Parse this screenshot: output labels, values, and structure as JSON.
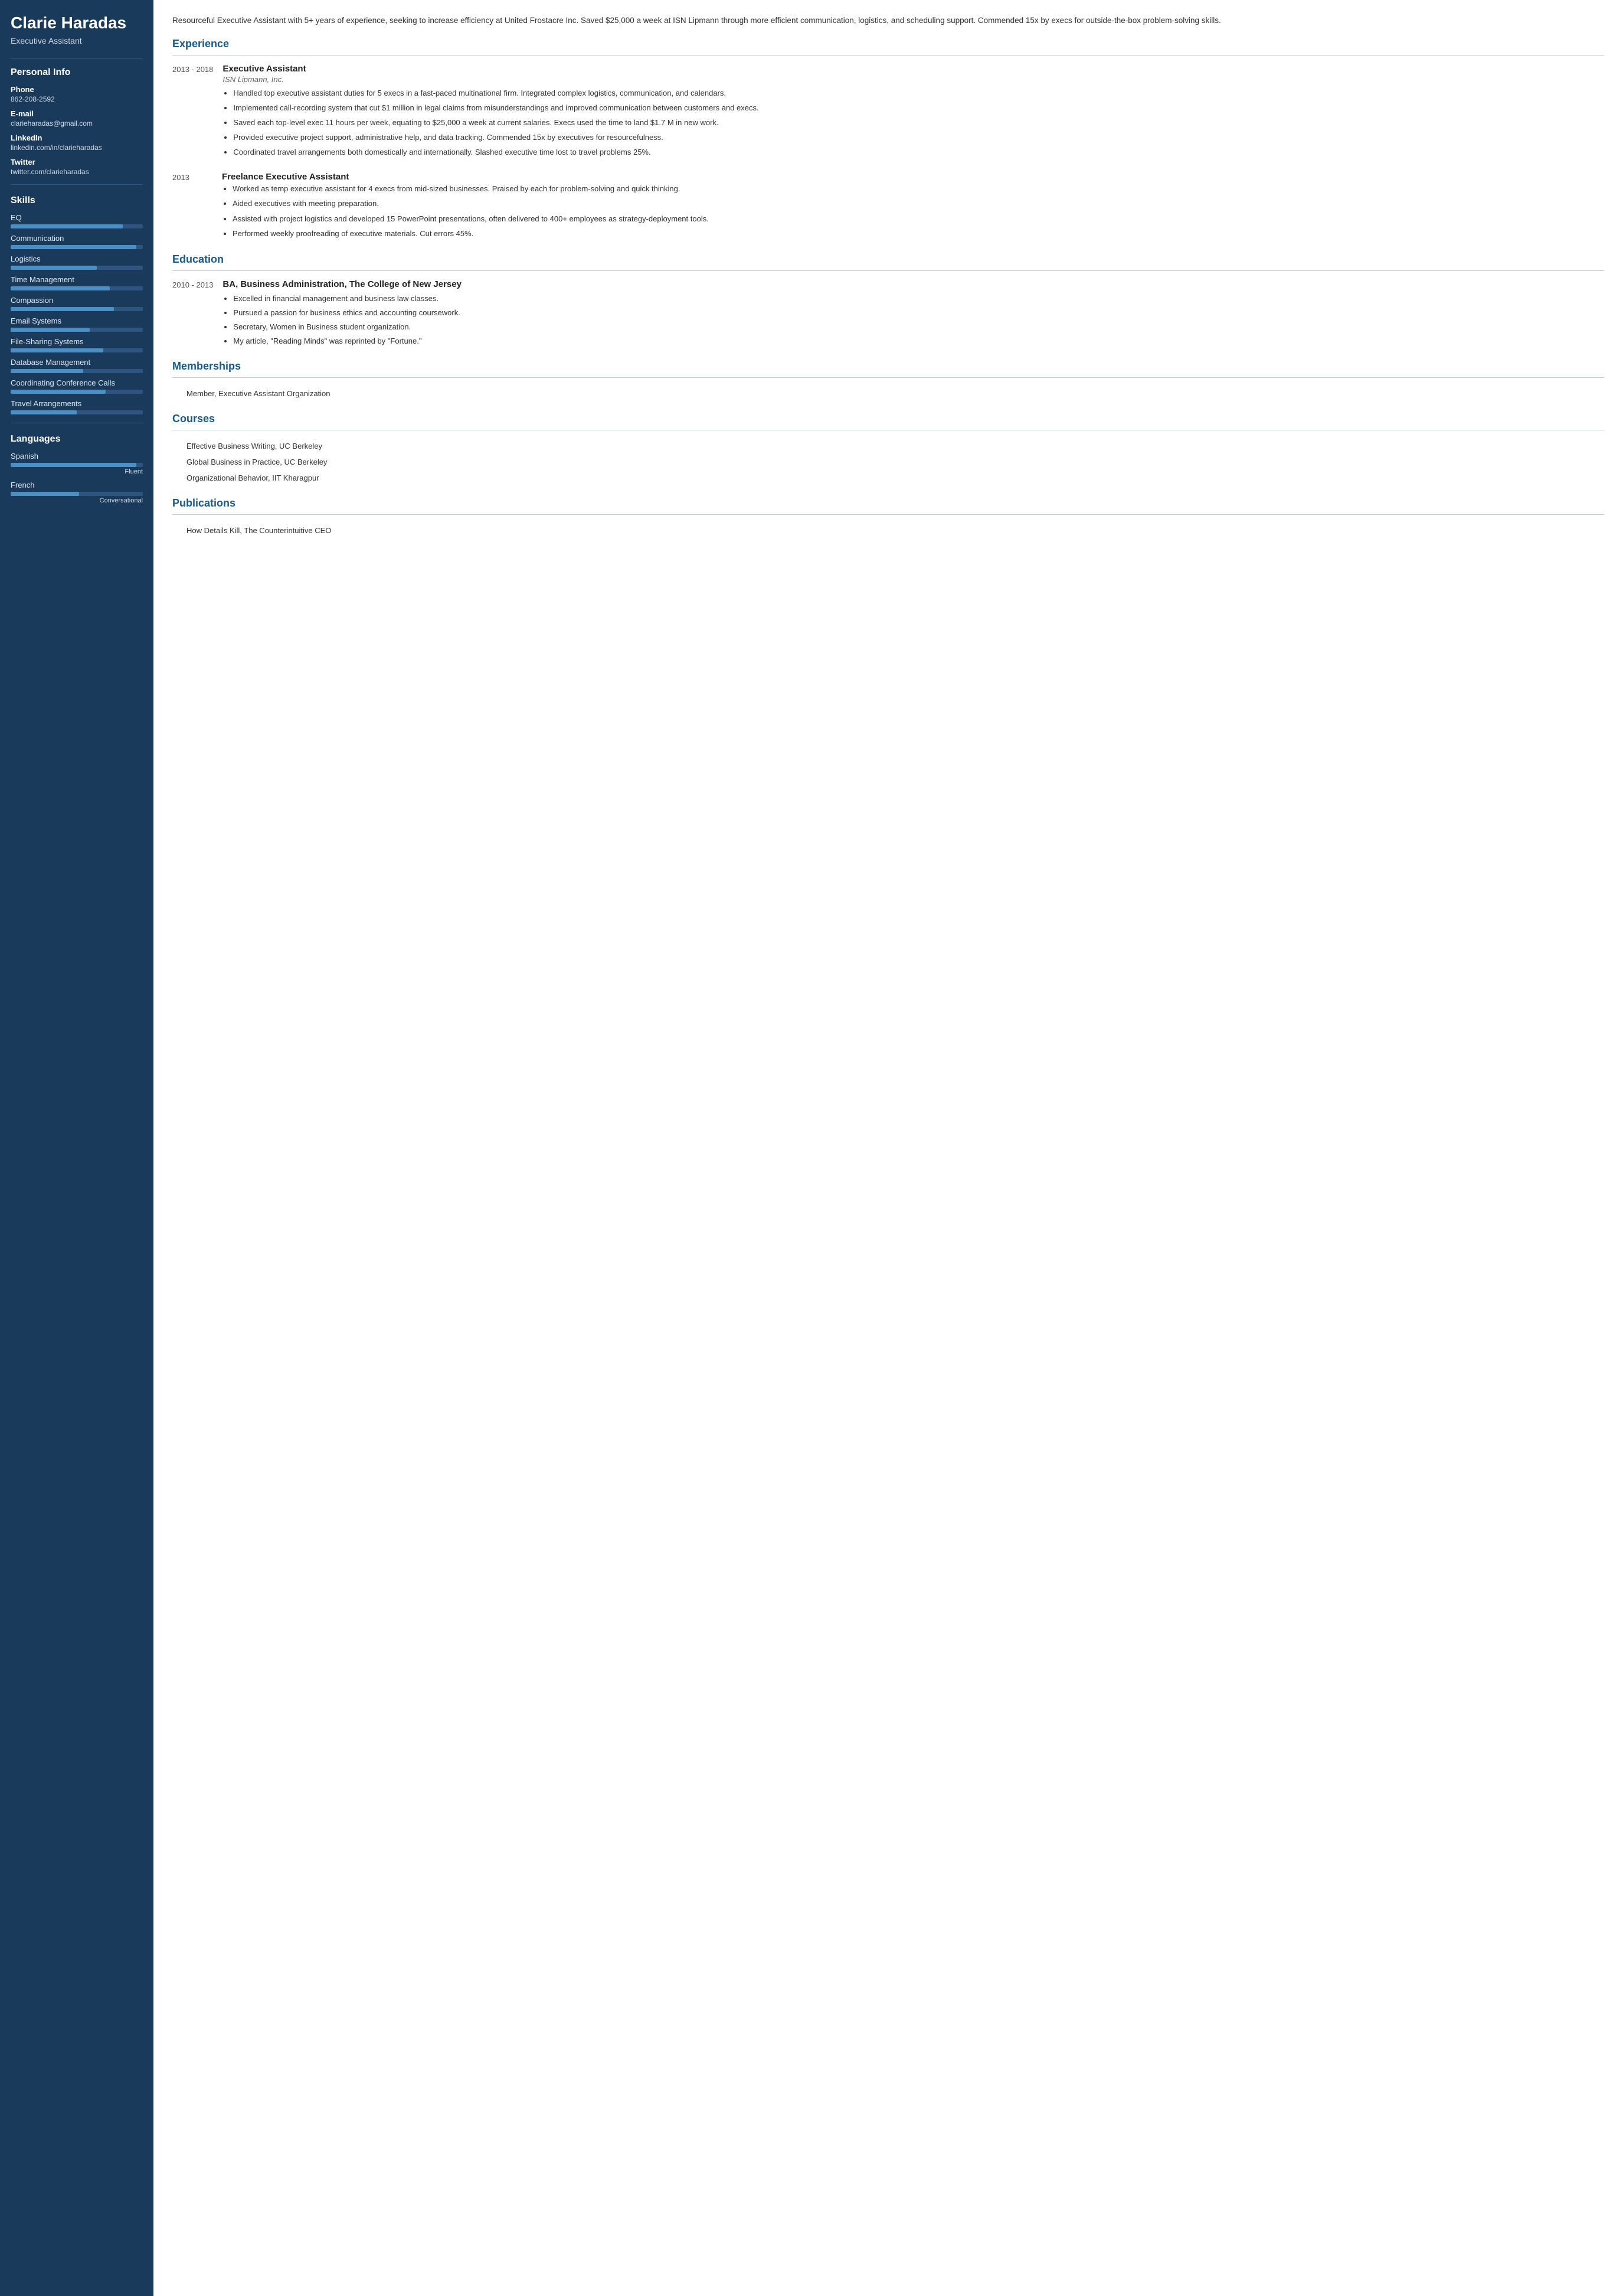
{
  "sidebar": {
    "name": "Clarie Haradas",
    "title": "Executive Assistant",
    "personal_info": {
      "section_title": "Personal Info",
      "phone_label": "Phone",
      "phone_value": "862-208-2592",
      "email_label": "E-mail",
      "email_value": "clarieharadas@gmail.com",
      "linkedin_label": "LinkedIn",
      "linkedin_value": "linkedin.com/in/clarieharadas",
      "twitter_label": "Twitter",
      "twitter_value": "twitter.com/clarieharadas"
    },
    "skills": {
      "section_title": "Skills",
      "items": [
        {
          "name": "EQ",
          "pct": 85
        },
        {
          "name": "Communication",
          "pct": 95
        },
        {
          "name": "Logistics",
          "pct": 65
        },
        {
          "name": "Time Management",
          "pct": 75
        },
        {
          "name": "Compassion",
          "pct": 78
        },
        {
          "name": "Email Systems",
          "pct": 60
        },
        {
          "name": "File-Sharing Systems",
          "pct": 70
        },
        {
          "name": "Database Management",
          "pct": 55
        },
        {
          "name": "Coordinating Conference Calls",
          "pct": 72
        },
        {
          "name": "Travel Arrangements",
          "pct": 50
        }
      ]
    },
    "languages": {
      "section_title": "Languages",
      "items": [
        {
          "name": "Spanish",
          "pct": 95,
          "level": "Fluent"
        },
        {
          "name": "French",
          "pct": 52,
          "level": "Conversational"
        }
      ]
    }
  },
  "main": {
    "summary": "Resourceful Executive Assistant with 5+ years of experience, seeking to increase efficiency at United Frostacre Inc. Saved $25,000 a week at ISN Lipmann through more efficient communication, logistics, and scheduling support. Commended 15x by execs for outside-the-box problem-solving skills.",
    "experience": {
      "section_title": "Experience",
      "entries": [
        {
          "date": "2013 - 2018",
          "title": "Executive Assistant",
          "company": "ISN Lipmann, Inc.",
          "bullets": [
            "Handled top executive assistant duties for 5 execs in a fast-paced multinational firm. Integrated complex logistics, communication, and calendars.",
            "Implemented call-recording system that cut $1 million in legal claims from misunderstandings and improved communication between customers and execs.",
            "Saved each top-level exec 11 hours per week, equating to $25,000 a week at current salaries. Execs used the time to land $1.7 M in new work.",
            "Provided executive project support, administrative help, and data tracking. Commended 15x by executives for resourcefulness.",
            "Coordinated travel arrangements both domestically and internationally. Slashed executive time lost to travel problems 25%."
          ]
        },
        {
          "date": "2013",
          "title": "Freelance Executive Assistant",
          "company": "",
          "bullets": [
            "Worked as temp executive assistant for 4 execs from mid-sized businesses. Praised by each for problem-solving and quick thinking.",
            "Aided executives with meeting preparation.",
            "Assisted with project logistics and developed 15 PowerPoint presentations, often delivered to 400+ employees as strategy-deployment tools.",
            "Performed weekly proofreading of executive materials. Cut errors 45%."
          ]
        }
      ]
    },
    "education": {
      "section_title": "Education",
      "entries": [
        {
          "date": "2010 - 2013",
          "degree": "BA, Business Administration, The College of New Jersey",
          "bullets": [
            "Excelled in financial management and business law classes.",
            "Pursued a passion for business ethics and accounting coursework.",
            "Secretary, Women in Business student organization.",
            "My article, \"Reading Minds\" was reprinted by \"Fortune.\""
          ]
        }
      ]
    },
    "memberships": {
      "section_title": "Memberships",
      "items": [
        "Member, Executive Assistant Organization"
      ]
    },
    "courses": {
      "section_title": "Courses",
      "items": [
        "Effective Business Writing, UC Berkeley",
        "Global Business in Practice, UC Berkeley",
        "Organizational Behavior, IIT Kharagpur"
      ]
    },
    "publications": {
      "section_title": "Publications",
      "items": [
        "How Details Kill, The Counterintuitive CEO"
      ]
    }
  }
}
